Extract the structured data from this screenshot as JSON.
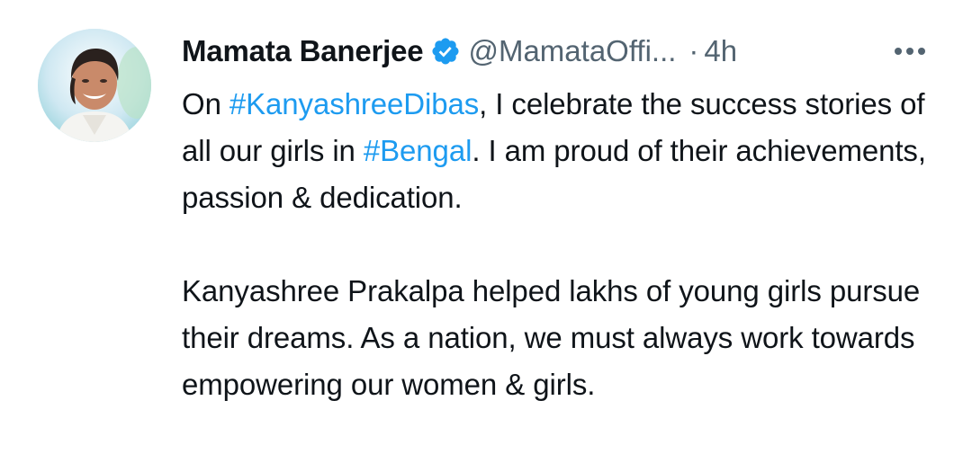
{
  "tweet": {
    "author": {
      "name": "Mamata Banerjee",
      "handle": "@MamataOffi...",
      "verified": true
    },
    "separator": "·",
    "time": "4h",
    "more_icon": "more-horizontal-icon",
    "paragraph1": {
      "part1": "On ",
      "hashtag1": "#KanyashreeDibas",
      "part2": ", I celebrate the success stories of all our girls in ",
      "hashtag2": "#Bengal",
      "part3": ". I am proud of their achievements, passion & dedication."
    },
    "paragraph2": "Kanyashree Prakalpa helped lakhs of young girls pursue their dreams. As a nation, we must always work towards  empowering our women & girls.",
    "colors": {
      "text": "#0f1419",
      "secondary": "#536471",
      "link": "#1d9bf0",
      "verified": "#1d9bf0"
    }
  }
}
